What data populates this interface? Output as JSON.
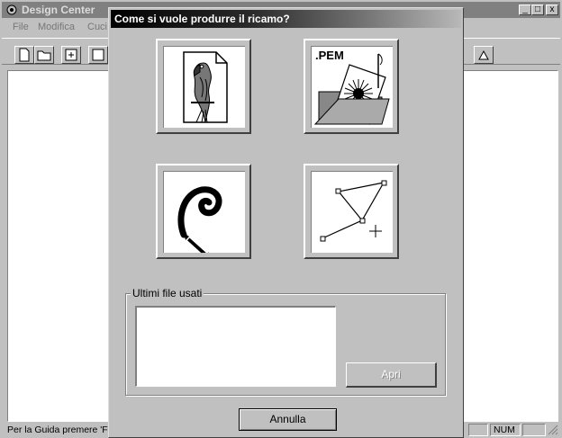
{
  "main_window": {
    "title": "Design Center",
    "controls": {
      "minimize": "_",
      "maximize": "□",
      "close": "x"
    },
    "menu": [
      "File",
      "Modifica",
      "Cuci"
    ],
    "status": {
      "hint": "Per la Guida premere 'F",
      "num": "NUM"
    }
  },
  "dialog": {
    "title": "Come si vuole produrre il ricamo?",
    "options": [
      {
        "icon": "parrot-image-file-icon"
      },
      {
        "icon": "pem-folder-icon",
        "label": ".PEM"
      },
      {
        "icon": "freehand-pen-icon"
      },
      {
        "icon": "point-to-point-icon"
      }
    ],
    "recent_files": {
      "label": "Ultimi file usati",
      "items": []
    },
    "open_label": "Apri",
    "cancel_label": "Annulla"
  }
}
